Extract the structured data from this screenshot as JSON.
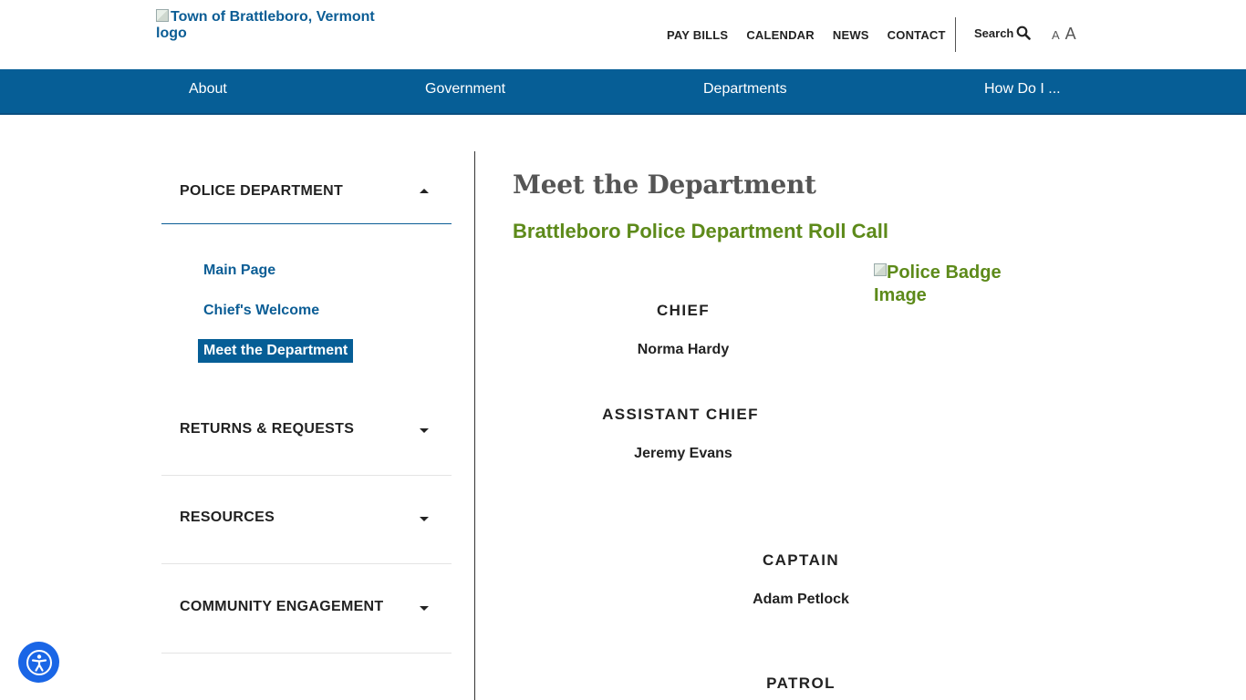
{
  "header": {
    "logo_alt": "Town of Brattleboro, Vermont logo",
    "utility_links": [
      "PAY BILLS",
      "CALENDAR",
      "NEWS",
      "CONTACT"
    ],
    "search_label": "Search",
    "font_small": "A",
    "font_large": "A"
  },
  "nav": {
    "items": [
      "About",
      "Government",
      "Departments",
      "How Do I ..."
    ]
  },
  "sidebar": {
    "section_title": "POLICE DEPARTMENT",
    "sub_items": [
      "Main Page",
      "Chief's Welcome",
      "Meet the Department"
    ],
    "active_sub": "Meet the Department",
    "sections": [
      "RETURNS & REQUESTS",
      "RESOURCES",
      "COMMUNITY ENGAGEMENT"
    ]
  },
  "main": {
    "title": "Meet the Department",
    "subtitle": "Brattleboro Police Department Roll Call",
    "badge_alt": "Police Badge Image",
    "roster": [
      {
        "role": "CHIEF",
        "name": "Norma Hardy"
      },
      {
        "role": "ASSISTANT CHIEF",
        "name": "Jeremy Evans"
      },
      {
        "role": "CAPTAIN",
        "name": "Adam Petlock"
      },
      {
        "role": "PATROL",
        "name": ""
      }
    ]
  },
  "colors": {
    "brand_blue": "#065e96",
    "link_blue": "#0b5d95",
    "accent_green": "#5d8a1a",
    "a11y_blue": "#1a66e6"
  }
}
